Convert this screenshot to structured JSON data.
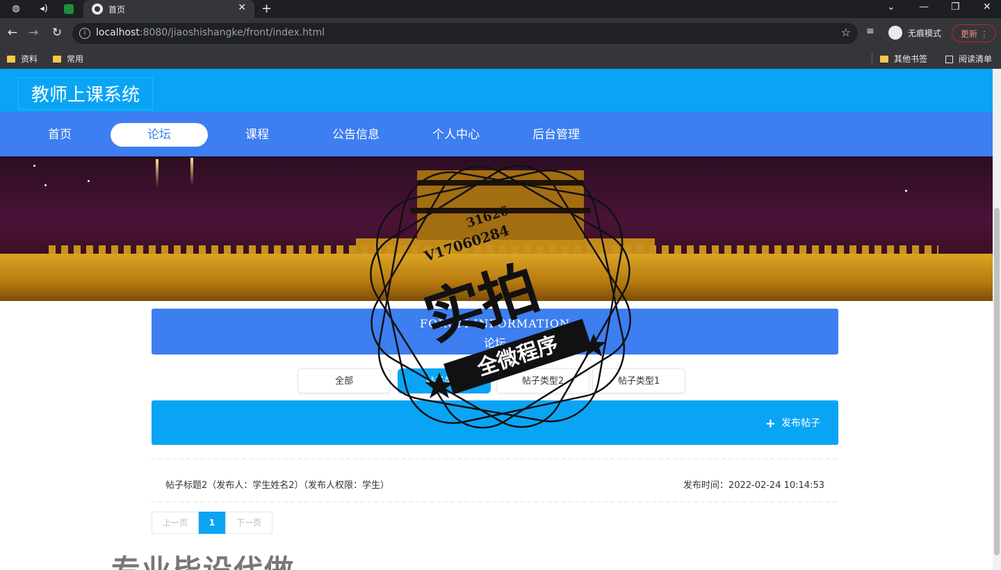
{
  "browser": {
    "tab_title": "首页",
    "url_host": "localhost",
    "url_rest": ":8080/jiaoshishangke/front/index.html",
    "incognito_label": "无痕模式",
    "update_label": "更新",
    "bookmarks": [
      "资料",
      "常用"
    ],
    "bookmarks_right": [
      "其他书签",
      "阅读清单"
    ]
  },
  "site": {
    "title": "教师上课系统",
    "nav": [
      {
        "label": "首页"
      },
      {
        "label": "论坛",
        "active": true
      },
      {
        "label": "课程"
      },
      {
        "label": "公告信息"
      },
      {
        "label": "个人中心"
      },
      {
        "label": "后台管理"
      }
    ]
  },
  "forum": {
    "heading_en": "FORUM INFORMATION",
    "heading_cn": "论坛",
    "types": [
      {
        "label": "全部"
      },
      {
        "label": "帖子类型",
        "active": true
      },
      {
        "label": "帖子类型2"
      },
      {
        "label": "帖子类型1"
      }
    ],
    "post_button": "发布帖子",
    "posts": [
      {
        "title": "帖子标题2（发布人：学生姓名2）（发布人权限：学生）",
        "time": "发布时间：2022-02-24 10:14:53"
      }
    ],
    "pager": {
      "prev": "上一页",
      "current": "1",
      "next": "下一页"
    }
  },
  "watermark": {
    "big": "实拍",
    "band": "全微程序",
    "code1": "V17060284",
    "code2": "31626",
    "bottom": "专业毕设代做"
  },
  "colors": {
    "header": "#0aa4f5",
    "nav": "#3d7ef0",
    "accent": "#0aa4f5"
  }
}
